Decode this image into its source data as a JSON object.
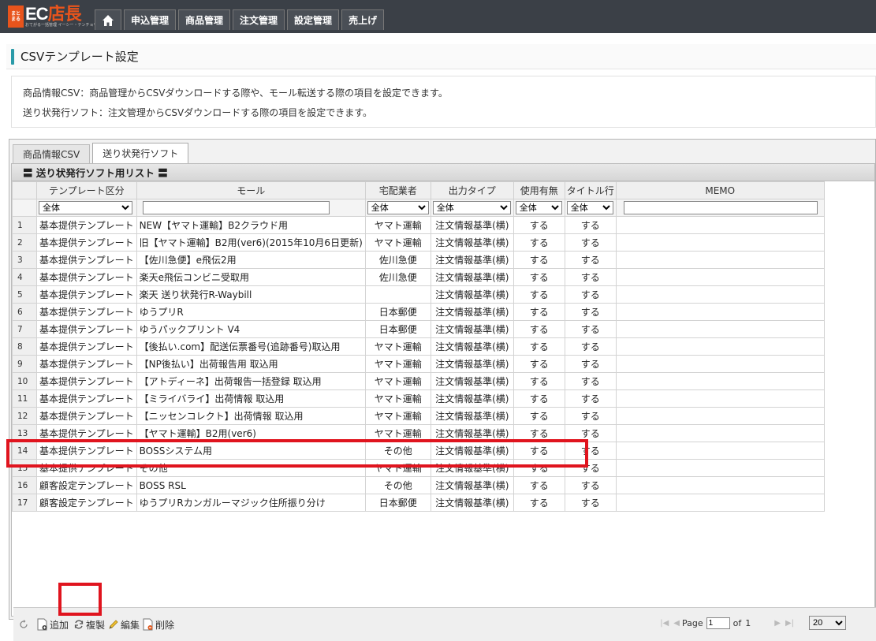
{
  "logo": {
    "badge_top": "まと",
    "badge_bottom": "まる",
    "ec": "EC",
    "tencho": "店長",
    "sub": "おてがる一括管理 イーシー・テンチョウ"
  },
  "nav": {
    "home_icon": "home-icon",
    "items": [
      "申込管理",
      "商品管理",
      "注文管理",
      "設定管理",
      "売上げ"
    ]
  },
  "page": {
    "title": "CSVテンプレート設定"
  },
  "description": [
    "商品情報CSV：商品管理からCSVダウンロードする際や、モール転送する際の項目を設定できます。",
    "送り状発行ソフト：注文管理からCSVダウンロードする際の項目を設定できます。"
  ],
  "tabs": [
    "商品情報CSV",
    "送り状発行ソフト"
  ],
  "list_title": "〓 送り状発行ソフト用リスト 〓",
  "columns": [
    "テンプレート区分",
    "モール",
    "宅配業者",
    "出力タイプ",
    "使用有無",
    "タイトル行",
    "MEMO"
  ],
  "filters": {
    "template": "全体",
    "carrier": "全体",
    "output": "全体",
    "usage": "全体",
    "title_row": "全体"
  },
  "rows": [
    [
      "1",
      "基本提供テンプレート",
      "NEW【ヤマト運輸】B2クラウド用",
      "ヤマト運輸",
      "注文情報基準(横)",
      "する",
      "する",
      ""
    ],
    [
      "2",
      "基本提供テンプレート",
      "旧【ヤマト運輸】B2用(ver6)(2015年10月6日更新)",
      "ヤマト運輸",
      "注文情報基準(横)",
      "する",
      "する",
      ""
    ],
    [
      "3",
      "基本提供テンプレート",
      "【佐川急便】e飛伝2用",
      "佐川急便",
      "注文情報基準(横)",
      "する",
      "する",
      ""
    ],
    [
      "4",
      "基本提供テンプレート",
      "楽天e飛伝コンビニ受取用",
      "佐川急便",
      "注文情報基準(横)",
      "する",
      "する",
      ""
    ],
    [
      "5",
      "基本提供テンプレート",
      "楽天 送り状発行R-Waybill",
      "",
      "注文情報基準(横)",
      "する",
      "する",
      ""
    ],
    [
      "6",
      "基本提供テンプレート",
      "ゆうプリR",
      "日本郵便",
      "注文情報基準(横)",
      "する",
      "する",
      ""
    ],
    [
      "7",
      "基本提供テンプレート",
      "ゆうパックプリント V4",
      "日本郵便",
      "注文情報基準(横)",
      "する",
      "する",
      ""
    ],
    [
      "8",
      "基本提供テンプレート",
      "【後払い.com】配送伝票番号(追跡番号)取込用",
      "ヤマト運輸",
      "注文情報基準(横)",
      "する",
      "する",
      ""
    ],
    [
      "9",
      "基本提供テンプレート",
      "【NP後払い】出荷報告用 取込用",
      "ヤマト運輸",
      "注文情報基準(横)",
      "する",
      "する",
      ""
    ],
    [
      "10",
      "基本提供テンプレート",
      "【アトディーネ】出荷報告一括登録 取込用",
      "ヤマト運輸",
      "注文情報基準(横)",
      "する",
      "する",
      ""
    ],
    [
      "11",
      "基本提供テンプレート",
      "【ミライバライ】出荷情報 取込用",
      "ヤマト運輸",
      "注文情報基準(横)",
      "する",
      "する",
      ""
    ],
    [
      "12",
      "基本提供テンプレート",
      "【ニッセンコレクト】出荷情報 取込用",
      "ヤマト運輸",
      "注文情報基準(横)",
      "する",
      "する",
      ""
    ],
    [
      "13",
      "基本提供テンプレート",
      "【ヤマト運輸】B2用(ver6)",
      "ヤマト運輸",
      "注文情報基準(横)",
      "する",
      "する",
      ""
    ],
    [
      "14",
      "基本提供テンプレート",
      "BOSSシステム用",
      "その他",
      "注文情報基準(横)",
      "する",
      "する",
      ""
    ],
    [
      "15",
      "基本提供テンプレート",
      "その他",
      "ヤマト運輸",
      "注文情報基準(横)",
      "する",
      "する",
      ""
    ],
    [
      "16",
      "顧客設定テンプレート",
      "BOSS RSL",
      "その他",
      "注文情報基準(横)",
      "する",
      "する",
      ""
    ],
    [
      "17",
      "顧客設定テンプレート",
      "ゆうプリRカンガルーマジック住所振り分け",
      "日本郵便",
      "注文情報基準(横)",
      "する",
      "する",
      ""
    ]
  ],
  "toolbar": {
    "add": "追加",
    "copy": "複製",
    "edit": "編集",
    "delete": "削除"
  },
  "pager": {
    "page_label": "Page",
    "page_value": "1",
    "of_label": "of",
    "total": "1",
    "page_size": "20"
  },
  "colors": {
    "accent": "#2a9aa8",
    "highlight": "#e0141e",
    "topbar": "#3b4047"
  }
}
